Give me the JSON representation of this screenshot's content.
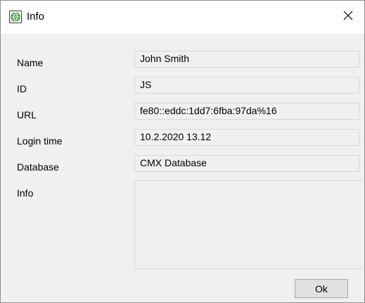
{
  "window": {
    "title": "Info",
    "close_label": "✕"
  },
  "labels": {
    "name": "Name",
    "id": "ID",
    "url": "URL",
    "login_time": "Login time",
    "database": "Database",
    "info": "Info"
  },
  "fields": {
    "name": "John Smith",
    "id": "JS",
    "url": "fe80::eddc:1dd7:6fba:97da%16",
    "login_time": "10.2.2020 13.12",
    "database": "CMX Database",
    "info": ""
  },
  "buttons": {
    "ok": "Ok"
  },
  "icons": {
    "app": "globe-network-icon",
    "close": "close-icon"
  },
  "colors": {
    "dialog_background": "#f0f0f0",
    "titlebar_background": "#ffffff",
    "icon_green": "#3c9a3c"
  }
}
